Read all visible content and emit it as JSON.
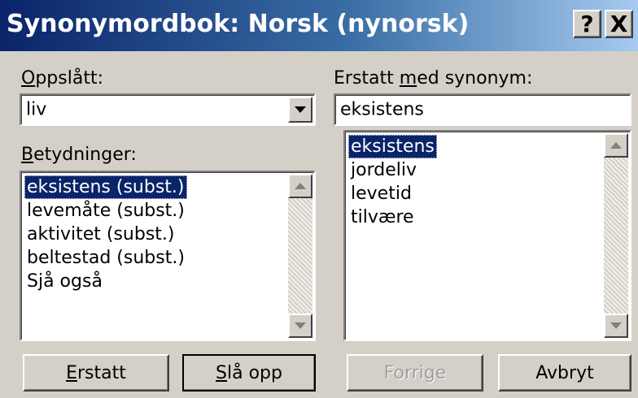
{
  "window": {
    "title": "Synonymordbok: Norsk (nynorsk)",
    "help_button": "?",
    "close_button": "X"
  },
  "lookup": {
    "label_accel": "O",
    "label_rest": "ppslått:",
    "value": "liv"
  },
  "meanings": {
    "label_accel": "B",
    "label_rest": "etydninger:",
    "items": [
      "eksistens (subst.)",
      "levemåte (subst.)",
      "aktivitet (subst.)",
      "beltestad (subst.)",
      "Sjå også"
    ],
    "selected_index": 0
  },
  "replace": {
    "label_pre": "Erstatt ",
    "label_accel": "m",
    "label_post": "ed synonym:",
    "value": "eksistens"
  },
  "synonyms": {
    "items": [
      "eksistens",
      "jordeliv",
      "levetid",
      "tilvære"
    ],
    "selected_index": 0
  },
  "buttons": {
    "replace_accel": "E",
    "replace_rest": "rstatt",
    "lookup_accel": "S",
    "lookup_rest": "lå opp",
    "previous": "Forrige",
    "cancel": "Avbryt"
  },
  "colors": {
    "titlebar_start": "#0a246a",
    "titlebar_end": "#a6caf0",
    "selection": "#0a246a",
    "face": "#d4d0c8"
  },
  "icons": {
    "dropdown": "chevron-down-icon",
    "scroll_up": "arrow-up-icon",
    "scroll_down": "arrow-down-icon"
  }
}
